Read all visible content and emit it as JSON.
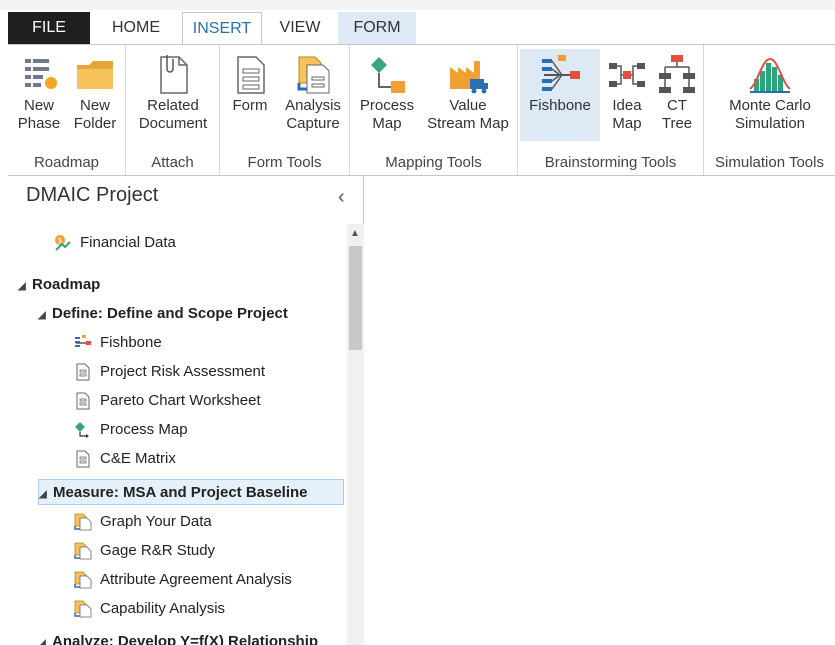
{
  "tabs": [
    "FILE",
    "HOME",
    "INSERT",
    "VIEW",
    "FORM"
  ],
  "ribbon": {
    "groups": [
      {
        "label": "Roadmap",
        "buttons": [
          "New\nPhase",
          "New\nFolder"
        ]
      },
      {
        "label": "Attach",
        "buttons": [
          "Related\nDocument"
        ]
      },
      {
        "label": "Form Tools",
        "buttons": [
          "Form",
          "Analysis\nCapture"
        ]
      },
      {
        "label": "Mapping Tools",
        "buttons": [
          "Process\nMap",
          "Value\nStream Map"
        ]
      },
      {
        "label": "Brainstorming Tools",
        "buttons": [
          "Fishbone",
          "Idea\nMap",
          "CT\nTree"
        ]
      },
      {
        "label": "Simulation Tools",
        "buttons": [
          "Monte Carlo\nSimulation"
        ]
      }
    ]
  },
  "panel": {
    "title": "DMAIC Project",
    "items": [
      {
        "label": "Financial Data"
      },
      {
        "label": "Roadmap"
      },
      {
        "label": "Define:  Define and Scope Project"
      },
      {
        "label": "Fishbone"
      },
      {
        "label": "Project Risk Assessment"
      },
      {
        "label": "Pareto Chart Worksheet"
      },
      {
        "label": "Process Map"
      },
      {
        "label": "C&E Matrix"
      },
      {
        "label": "Measure:  MSA and Project Baseline"
      },
      {
        "label": "Graph Your Data"
      },
      {
        "label": "Gage R&R Study"
      },
      {
        "label": "Attribute Agreement Analysis"
      },
      {
        "label": "Capability Analysis"
      },
      {
        "label": "Analyze:  Develop Y=f(X) Relationship"
      }
    ]
  }
}
